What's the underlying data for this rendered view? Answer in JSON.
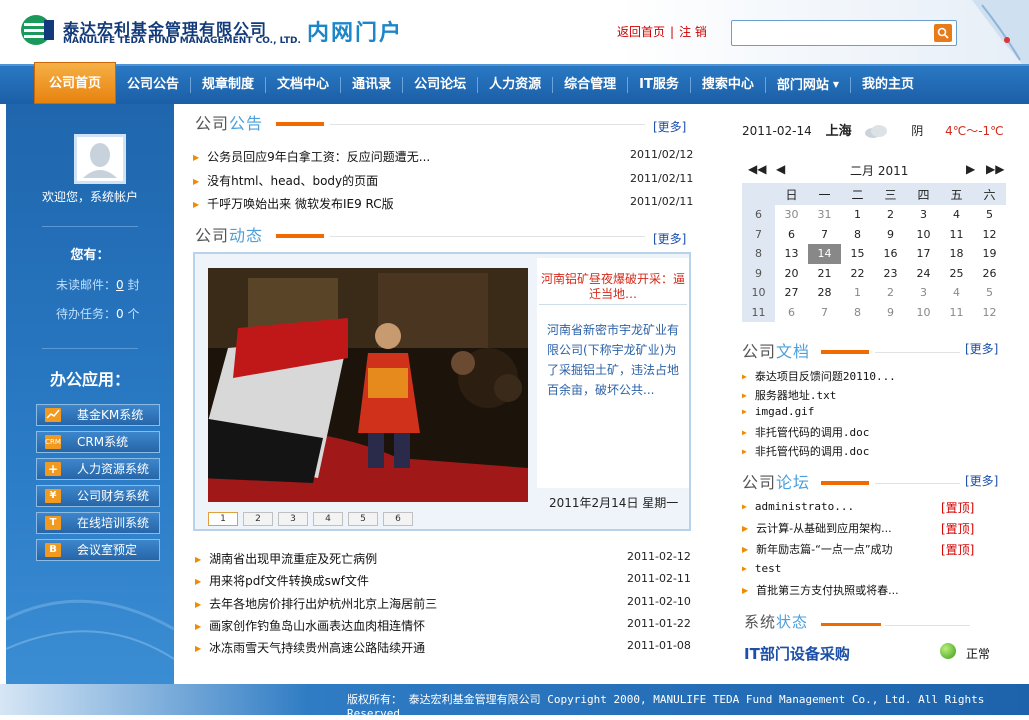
{
  "header": {
    "company_cn": "泰达宏利基金管理有限公司",
    "company_en": "MANULIFE TEDA FUND MANAGEMENT CO., LTD.",
    "portal_title": "内网门户",
    "link_home": "返回首页",
    "link_sep": "|",
    "link_logout": "注 销",
    "search_placeholder": "",
    "brand_color": "#1c86c8"
  },
  "nav": {
    "items": [
      "公司首页",
      "公司公告",
      "规章制度",
      "文档中心",
      "通讯录",
      "公司论坛",
      "人力资源",
      "综合管理",
      "IT服务",
      "搜索中心",
      "部门网站",
      "我的主页"
    ],
    "active": "公司首页"
  },
  "sidebar": {
    "welcome": "欢迎您，系统帐户",
    "you_label": "您有：",
    "mail_label": "未读邮件：",
    "mail_count": "0",
    "mail_unit": "封",
    "task_label": "待办任务：",
    "task_count": "0",
    "task_unit": "个",
    "office_title": "办公应用：",
    "apps": [
      {
        "label": "基金KM系统",
        "icon": "chart-icon"
      },
      {
        "label": "CRM系统",
        "icon": "crm-icon"
      },
      {
        "label": "人力资源系统",
        "icon": "plus-icon"
      },
      {
        "label": "公司财务系统",
        "icon": "yen-icon"
      },
      {
        "label": "在线培训系统",
        "icon": "t-icon"
      },
      {
        "label": "会议室预定",
        "icon": "b-icon"
      }
    ]
  },
  "announce": {
    "title_a": "公司",
    "title_b": "公告",
    "more": "[更多]",
    "items": [
      {
        "title": "公务员回应9年白拿工资：反应问题遭无...",
        "date": "2011/02/12"
      },
      {
        "title": "没有html、head、body的页面",
        "date": "2011/02/11"
      },
      {
        "title": "千呼万唤始出来 微软发布IE9 RC版",
        "date": "2011/02/11"
      }
    ]
  },
  "dynamics": {
    "title_a": "公司",
    "title_b": "动态",
    "more": "[更多]",
    "headline": "河南铝矿昼夜爆破开采：逼迁当地…",
    "desc": "河南省新密市宇龙矿业有限公司(下称宇龙矿业)为了采掘铝土矿，违法占地百余亩，破坏公共...",
    "date": "2011年2月14日 星期一",
    "pages": [
      "1",
      "2",
      "3",
      "4",
      "5",
      "6"
    ],
    "items": [
      {
        "title": "湖南省出现甲流重症及死亡病例",
        "date": "2011-02-12"
      },
      {
        "title": "用来将pdf文件转换成swf文件",
        "date": "2011-02-11"
      },
      {
        "title": "去年各地房价排行出炉杭州北京上海居前三",
        "date": "2011-02-10"
      },
      {
        "title": "画家创作钓鱼岛山水画表达血肉相连情怀",
        "date": "2011-01-22"
      },
      {
        "title": "冰冻雨雪天气持续贵州高速公路陆续开通",
        "date": "2011-01-08"
      }
    ]
  },
  "weather": {
    "date": "2011-02-14",
    "city": "上海",
    "condition": "阴",
    "temp": "4℃～-1℃"
  },
  "calendar": {
    "month_label": "二月 2011",
    "prev_year": "◀◀",
    "prev_month": "◀",
    "next_month": "▶",
    "next_year": "▶▶",
    "weekdays": [
      "日",
      "一",
      "二",
      "三",
      "四",
      "五",
      "六"
    ],
    "weeks": [
      {
        "wk": "6",
        "days": [
          "30",
          "31",
          "1",
          "2",
          "3",
          "4",
          "5"
        ]
      },
      {
        "wk": "7",
        "days": [
          "6",
          "7",
          "8",
          "9",
          "10",
          "11",
          "12"
        ]
      },
      {
        "wk": "8",
        "days": [
          "13",
          "14",
          "15",
          "16",
          "17",
          "18",
          "19"
        ]
      },
      {
        "wk": "9",
        "days": [
          "20",
          "21",
          "22",
          "23",
          "24",
          "25",
          "26"
        ]
      },
      {
        "wk": "10",
        "days": [
          "27",
          "28",
          "1",
          "2",
          "3",
          "4",
          "5"
        ]
      },
      {
        "wk": "11",
        "days": [
          "6",
          "7",
          "8",
          "9",
          "10",
          "11",
          "12"
        ]
      }
    ],
    "today": "14"
  },
  "docs": {
    "title_a": "公司",
    "title_b": "文档",
    "more": "[更多]",
    "items": [
      "泰达项目反馈问题20110...",
      "服务器地址.txt",
      "imgad.gif",
      "非托管代码的调用.doc",
      "非托管代码的调用.doc"
    ]
  },
  "forum": {
    "title_a": "公司",
    "title_b": "论坛",
    "more": "[更多]",
    "pin_label": "[置顶]",
    "items": [
      {
        "title": "administrato...",
        "pinned": true
      },
      {
        "title": "云计算-从基础到应用架构...",
        "pinned": true
      },
      {
        "title": "新年励志篇-“一点一点”成功",
        "pinned": true
      },
      {
        "title": "test",
        "pinned": false
      },
      {
        "title": "首批第三方支付执照或将春...",
        "pinned": false
      }
    ]
  },
  "system": {
    "title_a": "系统",
    "title_b": "状态",
    "link": "IT部门设备采购",
    "status": "正常",
    "status_color": "#3c9a1a"
  },
  "footer": {
    "text": "版权所有： 泰达宏利基金管理有限公司 Copyright 2000, MANULIFE TEDA Fund Management Co., Ltd. All Rights Reserved"
  }
}
